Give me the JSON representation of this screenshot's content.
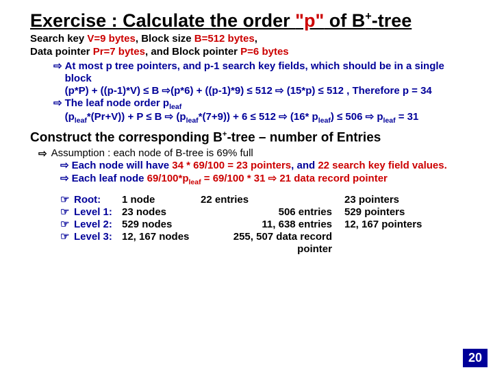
{
  "title": {
    "pre": "Exercise : Calculate the order ",
    "quoted": "\"p\"",
    "post": " of B",
    "sup": "+",
    "tail": "-tree"
  },
  "given": {
    "line1_a": "Search key ",
    "line1_b": "V=9 bytes",
    "line1_c": ", Block size ",
    "line1_d": "B=512 bytes",
    "line1_e": ",",
    "line2_a": "Data pointer ",
    "line2_b": "Pr=7 bytes",
    "line2_c": ", and Block pointer ",
    "line2_d": "P=6 bytes"
  },
  "b1": "At most p tree pointers, and p-1 search key fields, which should be in a single block",
  "b1a": "(p*P) + ((p-1)*V) ≤ B ⇨(p*6) + ((p-1)*9) ≤ 512 ⇨ (15*p) ≤ 512 ,  Therefore p = 34",
  "b2": "The leaf node order p",
  "b2sub": "leaf",
  "b2a_a": "(p",
  "b2a_b": "*(Pr+V)) + P ≤ B   ⇨   (p",
  "b2a_c": "*(7+9)) + 6 ≤ 512 ⇨ (16* p",
  "b2a_d": ") ≤ 506 ⇨ p",
  "b2a_e": " = 31",
  "section2_a": "Construct the corresponding B",
  "section2_b": "-tree – number of Entries",
  "assume": "Assumption : each node of B-tree is 69% full",
  "c1_a": "Each node will have ",
  "c1_b": "34 * 69/100 = 23 pointers",
  "c1_c": ", and ",
  "c1_d": "22 search key field values.",
  "c2_a": "Each leaf node ",
  "c2_b": "69/100*p",
  "c2_c": " = 69/100 * 31 ⇨ 21 data record pointer",
  "levels": [
    {
      "label": "Root:",
      "nodes": "1 node",
      "entries": "22 entries",
      "ptrs": "23 pointers"
    },
    {
      "label": "Level 1:",
      "nodes": "23 nodes",
      "entries": "506 entries",
      "ptrs": "529 pointers"
    },
    {
      "label": "Level 2:",
      "nodes": "529 nodes",
      "entries": "11, 638 entries",
      "ptrs": "12, 167 pointers"
    },
    {
      "label": "Level 3:",
      "nodes": "12, 167 nodes",
      "entries": "255, 507 data record pointer",
      "ptrs": ""
    }
  ],
  "pagenum": "20"
}
